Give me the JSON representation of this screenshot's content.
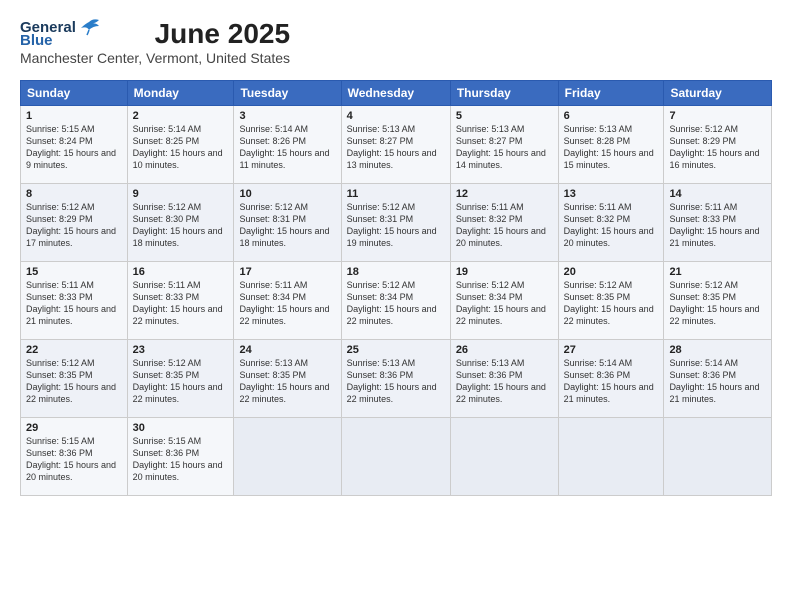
{
  "logo": {
    "general": "General",
    "blue": "Blue"
  },
  "header": {
    "month_year": "June 2025",
    "location": "Manchester Center, Vermont, United States"
  },
  "weekdays": [
    "Sunday",
    "Monday",
    "Tuesday",
    "Wednesday",
    "Thursday",
    "Friday",
    "Saturday"
  ],
  "weeks": [
    [
      {
        "day": 1,
        "sunrise": "5:15 AM",
        "sunset": "8:24 PM",
        "daylight": "15 hours and 9 minutes."
      },
      {
        "day": 2,
        "sunrise": "5:14 AM",
        "sunset": "8:25 PM",
        "daylight": "15 hours and 10 minutes."
      },
      {
        "day": 3,
        "sunrise": "5:14 AM",
        "sunset": "8:26 PM",
        "daylight": "15 hours and 11 minutes."
      },
      {
        "day": 4,
        "sunrise": "5:13 AM",
        "sunset": "8:27 PM",
        "daylight": "15 hours and 13 minutes."
      },
      {
        "day": 5,
        "sunrise": "5:13 AM",
        "sunset": "8:27 PM",
        "daylight": "15 hours and 14 minutes."
      },
      {
        "day": 6,
        "sunrise": "5:13 AM",
        "sunset": "8:28 PM",
        "daylight": "15 hours and 15 minutes."
      },
      {
        "day": 7,
        "sunrise": "5:12 AM",
        "sunset": "8:29 PM",
        "daylight": "15 hours and 16 minutes."
      }
    ],
    [
      {
        "day": 8,
        "sunrise": "5:12 AM",
        "sunset": "8:29 PM",
        "daylight": "15 hours and 17 minutes."
      },
      {
        "day": 9,
        "sunrise": "5:12 AM",
        "sunset": "8:30 PM",
        "daylight": "15 hours and 18 minutes."
      },
      {
        "day": 10,
        "sunrise": "5:12 AM",
        "sunset": "8:31 PM",
        "daylight": "15 hours and 18 minutes."
      },
      {
        "day": 11,
        "sunrise": "5:12 AM",
        "sunset": "8:31 PM",
        "daylight": "15 hours and 19 minutes."
      },
      {
        "day": 12,
        "sunrise": "5:11 AM",
        "sunset": "8:32 PM",
        "daylight": "15 hours and 20 minutes."
      },
      {
        "day": 13,
        "sunrise": "5:11 AM",
        "sunset": "8:32 PM",
        "daylight": "15 hours and 20 minutes."
      },
      {
        "day": 14,
        "sunrise": "5:11 AM",
        "sunset": "8:33 PM",
        "daylight": "15 hours and 21 minutes."
      }
    ],
    [
      {
        "day": 15,
        "sunrise": "5:11 AM",
        "sunset": "8:33 PM",
        "daylight": "15 hours and 21 minutes."
      },
      {
        "day": 16,
        "sunrise": "5:11 AM",
        "sunset": "8:33 PM",
        "daylight": "15 hours and 22 minutes."
      },
      {
        "day": 17,
        "sunrise": "5:11 AM",
        "sunset": "8:34 PM",
        "daylight": "15 hours and 22 minutes."
      },
      {
        "day": 18,
        "sunrise": "5:12 AM",
        "sunset": "8:34 PM",
        "daylight": "15 hours and 22 minutes."
      },
      {
        "day": 19,
        "sunrise": "5:12 AM",
        "sunset": "8:34 PM",
        "daylight": "15 hours and 22 minutes."
      },
      {
        "day": 20,
        "sunrise": "5:12 AM",
        "sunset": "8:35 PM",
        "daylight": "15 hours and 22 minutes."
      },
      {
        "day": 21,
        "sunrise": "5:12 AM",
        "sunset": "8:35 PM",
        "daylight": "15 hours and 22 minutes."
      }
    ],
    [
      {
        "day": 22,
        "sunrise": "5:12 AM",
        "sunset": "8:35 PM",
        "daylight": "15 hours and 22 minutes."
      },
      {
        "day": 23,
        "sunrise": "5:12 AM",
        "sunset": "8:35 PM",
        "daylight": "15 hours and 22 minutes."
      },
      {
        "day": 24,
        "sunrise": "5:13 AM",
        "sunset": "8:35 PM",
        "daylight": "15 hours and 22 minutes."
      },
      {
        "day": 25,
        "sunrise": "5:13 AM",
        "sunset": "8:36 PM",
        "daylight": "15 hours and 22 minutes."
      },
      {
        "day": 26,
        "sunrise": "5:13 AM",
        "sunset": "8:36 PM",
        "daylight": "15 hours and 22 minutes."
      },
      {
        "day": 27,
        "sunrise": "5:14 AM",
        "sunset": "8:36 PM",
        "daylight": "15 hours and 21 minutes."
      },
      {
        "day": 28,
        "sunrise": "5:14 AM",
        "sunset": "8:36 PM",
        "daylight": "15 hours and 21 minutes."
      }
    ],
    [
      {
        "day": 29,
        "sunrise": "5:15 AM",
        "sunset": "8:36 PM",
        "daylight": "15 hours and 20 minutes."
      },
      {
        "day": 30,
        "sunrise": "5:15 AM",
        "sunset": "8:36 PM",
        "daylight": "15 hours and 20 minutes."
      },
      null,
      null,
      null,
      null,
      null
    ]
  ]
}
